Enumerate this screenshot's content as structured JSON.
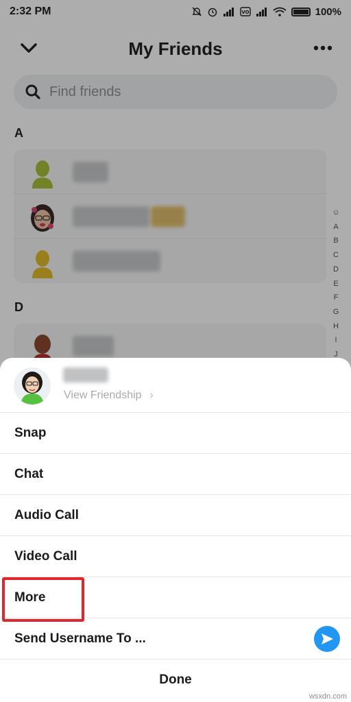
{
  "status_bar": {
    "time": "2:32 PM",
    "battery_text": "100%",
    "icons": [
      "mute-icon",
      "alarm-icon",
      "signal-icon",
      "volte-icon",
      "signal-icon",
      "wifi-icon",
      "battery-icon"
    ]
  },
  "header": {
    "title": "My Friends",
    "back_icon": "chevron-down-icon",
    "menu_icon": "more-dots-icon"
  },
  "search": {
    "placeholder": "Find friends",
    "icon": "search-icon"
  },
  "sections": [
    {
      "letter": "A",
      "friends": [
        {
          "avatar": "bitmoji-placeholder"
        },
        {
          "avatar": "bitmoji-girl"
        },
        {
          "avatar": "bitmoji-placeholder"
        }
      ]
    },
    {
      "letter": "D",
      "friends": [
        {
          "avatar": "bitmoji-man"
        }
      ]
    }
  ],
  "alpha_index": [
    "☺",
    "A",
    "B",
    "C",
    "D",
    "E",
    "F",
    "G",
    "H",
    "I",
    "J"
  ],
  "sheet": {
    "view_friendship_label": "View Friendship",
    "view_friendship_chevron": "›",
    "items": [
      "Snap",
      "Chat",
      "Audio Call",
      "Video Call",
      "More",
      "Send Username To ..."
    ],
    "done_label": "Done",
    "highlighted_item": "More",
    "send_icon": "send-arrow-icon"
  },
  "colors": {
    "accent_blue": "#2196f3",
    "highlight_red": "#e1262b",
    "search_bg": "#eef0f2"
  },
  "watermark": "wsxdn.com"
}
